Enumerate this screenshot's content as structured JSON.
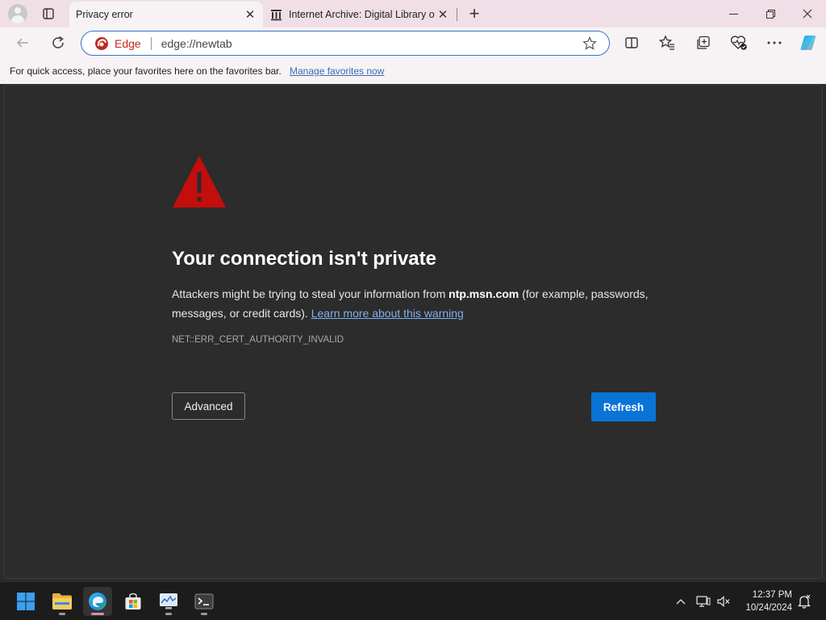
{
  "tabs": [
    {
      "title": "Privacy error",
      "active": true
    },
    {
      "title": "Internet Archive: Digital Library of",
      "active": false
    }
  ],
  "address": {
    "scheme_label": "Edge",
    "url": "edge://newtab"
  },
  "favorites_bar": {
    "message": "For quick access, place your favorites here on the favorites bar.",
    "manage_link": "Manage favorites now"
  },
  "page": {
    "heading": "Your connection isn't private",
    "body_pre": "Attackers might be trying to steal your information from ",
    "body_host": "ntp.msn.com",
    "body_post": " (for example, passwords, messages, or credit cards). ",
    "learn_more": "Learn more about this warning",
    "error_code": "NET::ERR_CERT_AUTHORITY_INVALID",
    "advanced_label": "Advanced",
    "refresh_label": "Refresh"
  },
  "taskbar": {
    "apps": [
      "start",
      "file-explorer",
      "edge",
      "store",
      "photos",
      "terminal"
    ],
    "active_app": "edge",
    "time": "12:37 PM",
    "date": "10/24/2024"
  },
  "colors": {
    "tab_strip": "#f0dfe6",
    "toolbar": "#f7f2f4",
    "page_bg": "#2c2c2c",
    "warning_red": "#c40d0d",
    "primary_button": "#0a74d6",
    "link": "#7cb0ec",
    "taskbar": "#1c1c1c"
  }
}
